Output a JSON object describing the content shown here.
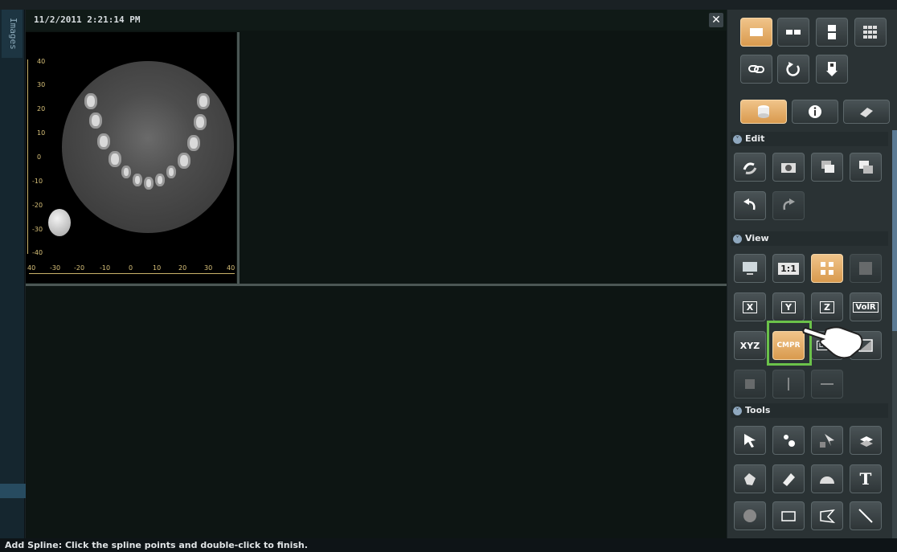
{
  "viewer": {
    "timestamp": "11/2/2011 2:21:14 PM",
    "close_label": "✕"
  },
  "sidebar_strip": {
    "tab_label": "Images"
  },
  "ruler": {
    "vertical_labels": [
      "40",
      "30",
      "20",
      "10",
      "0",
      "-10",
      "-20",
      "-30",
      "-40"
    ],
    "horizontal_labels": [
      "40",
      "-30",
      "-20",
      "-10",
      "0",
      "10",
      "20",
      "30",
      "40"
    ]
  },
  "panel": {
    "sections": {
      "edit": "Edit",
      "view": "View",
      "tools": "Tools"
    },
    "view_buttons": {
      "one_to_one": "1:1",
      "x": "X",
      "y": "Y",
      "z": "Z",
      "volr": "VolR",
      "xyz": "XYZ",
      "cmpr": "CMPR",
      "dual": "Dual"
    },
    "tools": {
      "text_tool": "T"
    }
  },
  "status_bar": {
    "message": "Add Spline: Click the spline points and double-click to finish."
  },
  "colors": {
    "accent_orange": "#e0a560",
    "highlight_green": "#6bc24a",
    "ruler_yellow": "#d9c27a"
  }
}
